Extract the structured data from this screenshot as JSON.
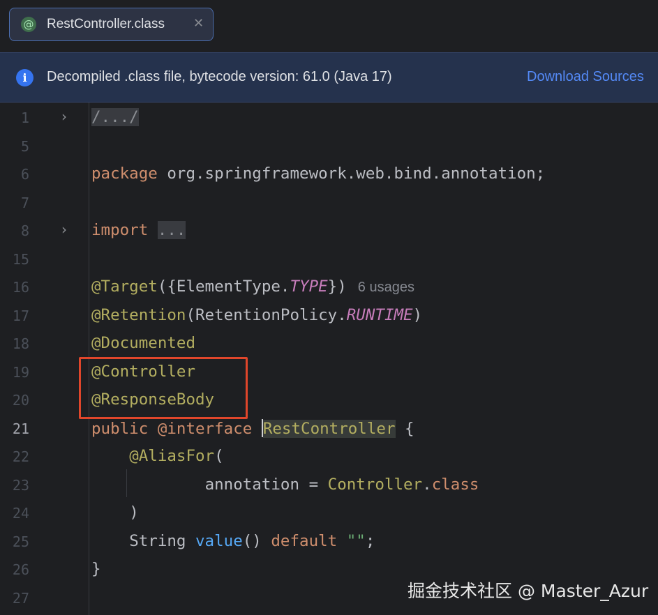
{
  "tab": {
    "icon": "@",
    "label": "RestController.class",
    "close": "✕"
  },
  "banner": {
    "icon": "i",
    "text": "Decompiled .class file, bytecode version: 61.0 (Java 17)",
    "link": "Download Sources"
  },
  "editor": {
    "lines": [
      {
        "n": "1"
      },
      {
        "n": "5"
      },
      {
        "n": "6"
      },
      {
        "n": "7"
      },
      {
        "n": "8"
      },
      {
        "n": "15"
      },
      {
        "n": "16"
      },
      {
        "n": "17"
      },
      {
        "n": "18"
      },
      {
        "n": "19"
      },
      {
        "n": "20"
      },
      {
        "n": "21"
      },
      {
        "n": "22"
      },
      {
        "n": "23"
      },
      {
        "n": "24"
      },
      {
        "n": "25"
      },
      {
        "n": "26"
      },
      {
        "n": "27"
      }
    ],
    "fold_glyph": "›",
    "code": {
      "l1": "/.../",
      "l6_kw": "package",
      "l6_rest": " org.springframework.web.bind.annotation;",
      "l8_kw": "import",
      "l8_fold": "...",
      "l16_ann": "@Target",
      "l16_a": "({ElementType.",
      "l16_const": "TYPE",
      "l16_b": "})",
      "l16_hint": "6 usages",
      "l17_ann": "@Retention",
      "l17_a": "(RetentionPolicy.",
      "l17_const": "RUNTIME",
      "l17_b": ")",
      "l18_ann": "@Documented",
      "l19_ann": "@Controller",
      "l20_ann": "@ResponseBody",
      "l21_kw1": "public",
      "l21_kw2": "@interface",
      "l21_name": "RestController",
      "l21_brace": " {",
      "l22_ann": "@AliasFor",
      "l22_paren": "(",
      "l23_a": "annotation = ",
      "l23_cls": "Controller",
      "l23_dot": ".",
      "l23_kw": "class",
      "l24": ")",
      "l25_type": "String ",
      "l25_fn": "value",
      "l25_paren": "() ",
      "l25_kw": "default",
      "l25_str": "\"\"",
      "l25_semi": ";",
      "l26": "}"
    }
  },
  "watermark": "掘金技术社区 @ Master_Azur"
}
